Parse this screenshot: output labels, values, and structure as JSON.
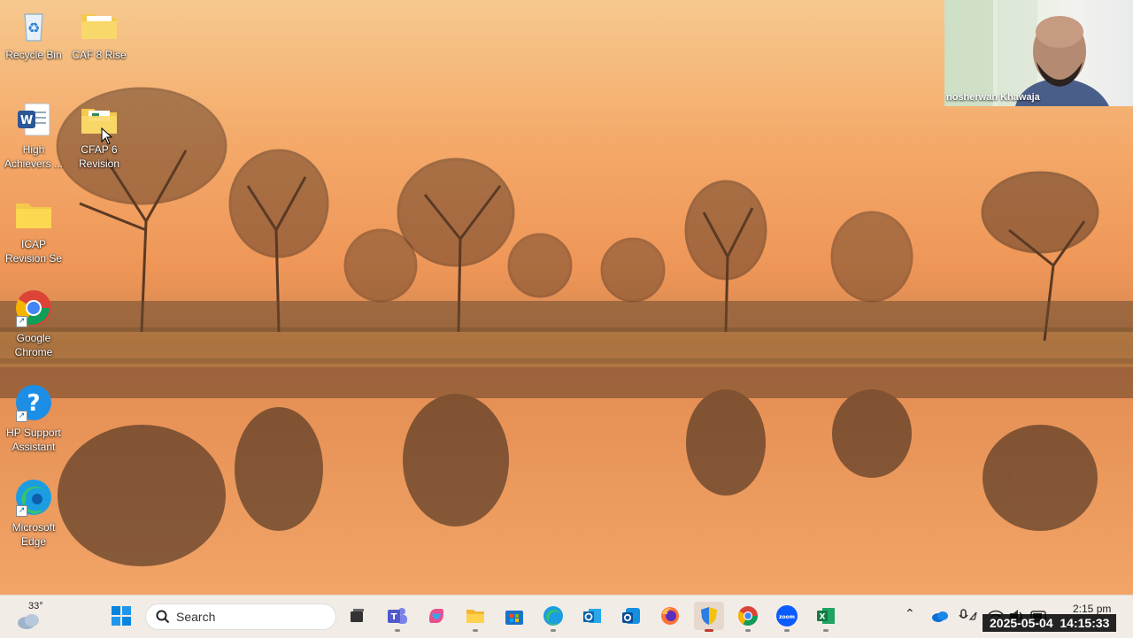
{
  "desktop": {
    "icons": [
      {
        "label": "Recycle Bin",
        "icon": "recycle-bin-icon"
      },
      {
        "label": "CAF 8 Rise",
        "icon": "folder-icon"
      },
      {
        "label": "High Achievers ...",
        "icon": "word-document-icon"
      },
      {
        "label": "CFAP 6 Revision",
        "icon": "folder-icon"
      },
      {
        "label": "ICAP Revision Se",
        "icon": "folder-icon"
      },
      {
        "label": "Google Chrome",
        "icon": "chrome-icon"
      },
      {
        "label": "HP Support Assistant",
        "icon": "hp-support-icon"
      },
      {
        "label": "Microsoft Edge",
        "icon": "edge-icon"
      }
    ]
  },
  "webcam": {
    "participant_name": "nosherwan Khawaja"
  },
  "taskbar": {
    "weather_temp": "33°",
    "search_label": "Search",
    "apps": [
      "start-icon",
      "task-view-icon",
      "teams-icon",
      "copilot-icon",
      "file-explorer-icon",
      "microsoft-store-icon",
      "edge-icon",
      "outlook-icon",
      "outlook-new-icon",
      "firefox-icon",
      "security-shield-icon",
      "chrome-icon",
      "zoom-icon",
      "excel-icon"
    ],
    "tray": {
      "time": "2:15 pm"
    }
  },
  "recording_timestamp": "2025-05-04  14:15:33",
  "colors": {
    "accent": "#0078d4",
    "sky_top": "#f6c98e",
    "sky_mid": "#ee9658",
    "grass": "#b3763f"
  }
}
